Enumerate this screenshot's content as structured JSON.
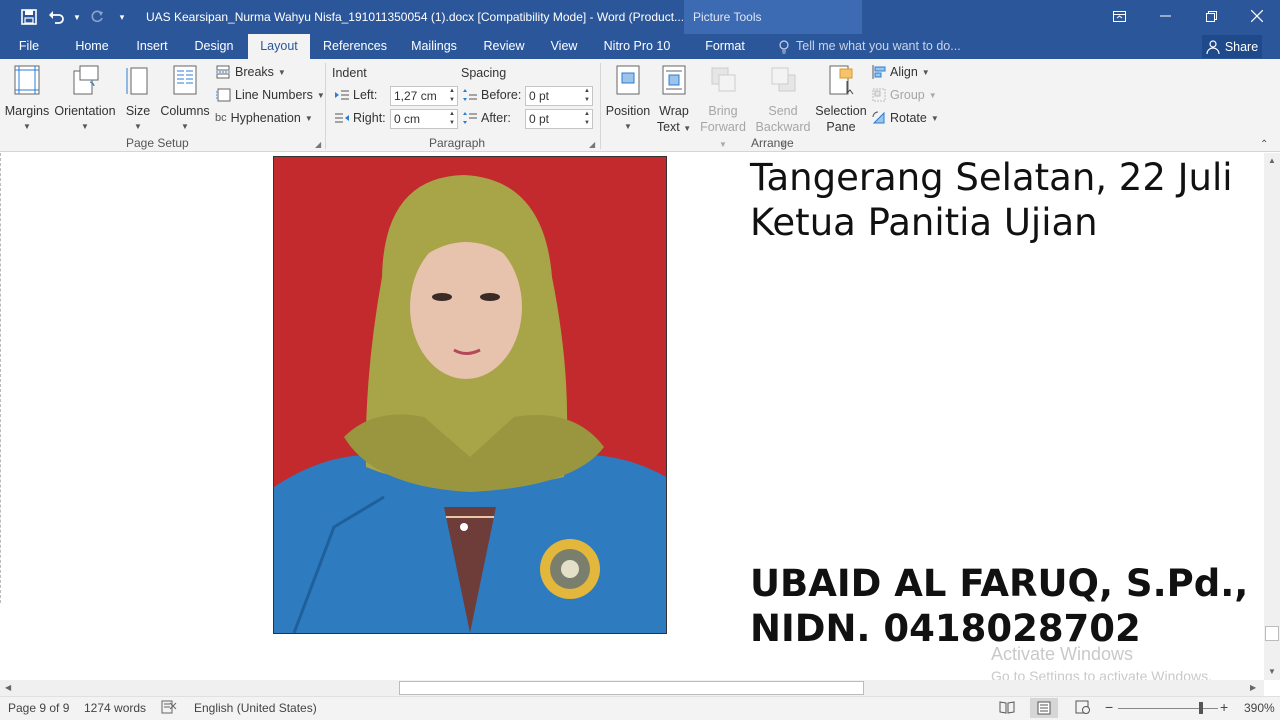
{
  "titlebar": {
    "doc_title": "UAS Kearsipan_Nurma Wahyu Nisfa_191011350054 (1).docx [Compatibility Mode] - Word (Product...",
    "contextual_tools": "Picture Tools"
  },
  "tabs": [
    "File",
    "Home",
    "Insert",
    "Design",
    "Layout",
    "References",
    "Mailings",
    "Review",
    "View",
    "Nitro Pro 10",
    "Format"
  ],
  "active_tab": "Layout",
  "tell_me": "Tell me what you want to do...",
  "share": "Share",
  "ribbon": {
    "page_setup": {
      "group": "Page Setup",
      "margins": "Margins",
      "orientation": "Orientation",
      "size": "Size",
      "columns": "Columns",
      "breaks": "Breaks",
      "line_numbers": "Line Numbers",
      "hyphenation": "Hyphenation"
    },
    "paragraph": {
      "group": "Paragraph",
      "indent": "Indent",
      "spacing": "Spacing",
      "left_label": "Left:",
      "left_value": "1,27 cm",
      "right_label": "Right:",
      "right_value": "0 cm",
      "before_label": "Before:",
      "before_value": "0 pt",
      "after_label": "After:",
      "after_value": "0 pt"
    },
    "arrange": {
      "group": "Arrange",
      "position": "Position",
      "wrap_text_1": "Wrap",
      "wrap_text_2": "Text",
      "bring_forward_1": "Bring",
      "bring_forward_2": "Forward",
      "send_backward_1": "Send",
      "send_backward_2": "Backward",
      "selection_pane_1": "Selection",
      "selection_pane_2": "Pane",
      "align": "Align",
      "group_btn": "Group",
      "rotate": "Rotate"
    }
  },
  "document": {
    "line1": "Tangerang Selatan, 22 Juli",
    "line2": "Ketua Panitia Ujian",
    "line3": "UBAID AL FARUQ, S.Pd.,",
    "line4": "NIDN. 0418028702"
  },
  "watermark": {
    "line1": "Activate Windows",
    "line2": "Go to Settings to activate Windows."
  },
  "status": {
    "page": "Page 9 of 9",
    "words": "1274 words",
    "language": "English (United States)",
    "zoom": "390%"
  },
  "colors": {
    "brand": "#2b579a",
    "photo_background": "#c22a2e"
  }
}
